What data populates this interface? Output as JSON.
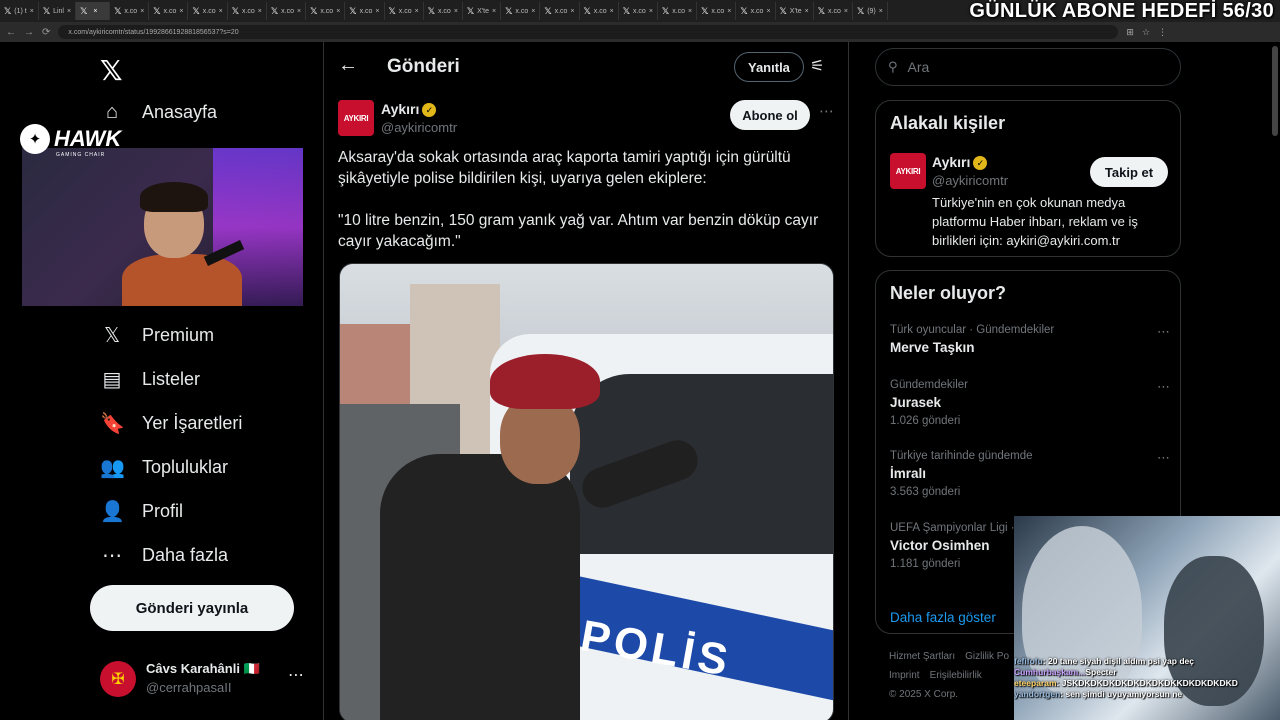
{
  "browser": {
    "tabs": [
      "(1) t",
      "Linl",
      "",
      "x.co",
      "x.co",
      "x.co",
      "x.co",
      "x.co",
      "x.co",
      "x.co",
      "x.co",
      "x.co",
      "X'te",
      "x.co",
      "x.co",
      "x.co",
      "x.co",
      "x.co",
      "x.co",
      "x.co",
      "X'te",
      "x.co",
      "(9)"
    ],
    "url": "x.com/aykiricomtr/status/1992866192881856537?s=20"
  },
  "overlay": {
    "goal_text": "GÜNLÜK ABONE HEDEFİ 56/30",
    "brand": "HAWK",
    "brand_sub": "GAMING CHAIR"
  },
  "nav": {
    "logo": "𝕏",
    "items": [
      {
        "label": "Anasayfa",
        "icon": "home-icon",
        "glyph": "⌂"
      },
      {
        "label": "Premium",
        "icon": "x-premium-icon",
        "glyph": "𝕏"
      },
      {
        "label": "Listeler",
        "icon": "lists-icon",
        "glyph": "▤"
      },
      {
        "label": "Yer İşaretleri",
        "icon": "bookmark-icon",
        "glyph": "🔖"
      },
      {
        "label": "Topluluklar",
        "icon": "communities-icon",
        "glyph": "👥"
      },
      {
        "label": "Profil",
        "icon": "profile-icon",
        "glyph": "👤"
      },
      {
        "label": "Daha fazla",
        "icon": "more-circle-icon",
        "glyph": "⋯"
      }
    ],
    "post_button": "Gönderi yayınla",
    "account": {
      "name": "Câvs Karahânli 🇮🇹",
      "handle": "@cerrahpasaII",
      "avatar_text": "✠"
    }
  },
  "main": {
    "title": "Gönderi",
    "reply_button": "Yanıtla",
    "post": {
      "avatar_text": "AYKIRI",
      "name": "Aykırı",
      "handle": "@aykiricomtr",
      "subscribe_button": "Abone ol",
      "text_1": "Aksaray'da sokak ortasında araç kaporta tamiri yaptığı için gürültü şikâyetiyle polise bildirilen kişi, uyarıya gelen ekiplere:",
      "text_2": "\"10 litre benzin, 150 gram yanık yağ var. Ahtım var benzin döküp cayır cayır yakacağım.\"",
      "media_text": "POLİS"
    }
  },
  "right": {
    "search_placeholder": "Ara",
    "related": {
      "title": "Alakalı kişiler",
      "avatar_text": "AYKIRI",
      "name": "Aykırı",
      "handle": "@aykiricomtr",
      "follow_button": "Takip et",
      "bio": "Türkiye'nin en çok okunan medya platformu Haber ihbarı, reklam ve iş birlikleri için: aykiri@aykiri.com.tr"
    },
    "trends": {
      "title": "Neler oluyor?",
      "items": [
        {
          "category": "Türk oyuncular · Gündemdekiler",
          "name": "Merve Taşkın",
          "count": ""
        },
        {
          "category": "Gündemdekiler",
          "name": "Jurasek",
          "count": "1.026 gönderi"
        },
        {
          "category": "Türkiye tarihinde gündemde",
          "name": "İmralı",
          "count": "3.563 gönderi"
        },
        {
          "category": "UEFA Şampiyonlar Ligi · Gündemdekiler",
          "name": "Victor Osimhen",
          "count": "1.181 gönderi"
        }
      ],
      "show_more": "Daha fazla göster"
    },
    "footer": {
      "links": [
        "Hizmet Şartları",
        "Gizlilik Po",
        "Imprint",
        "Erişilebilirlik"
      ],
      "copyright": "© 2025 X Corp."
    }
  },
  "chat": [
    {
      "user": "fefifofu",
      "text": ": 20 tane siyah dişil aldım psi yap deç"
    },
    {
      "user": "Cumhurbaşkanı...",
      "text": "Specter"
    },
    {
      "user": "eteeparam",
      "text": ": JSKDKDKDKDKDKDKDKDKKDKDKDKDKD"
    },
    {
      "user": "yandortgen",
      "text": ": sen şimdi uyuyamıyorsun ne"
    }
  ],
  "colors": {
    "accent": "#1d9bf0",
    "verified_gold": "#e2b719",
    "brand_red": "#c8102e"
  }
}
